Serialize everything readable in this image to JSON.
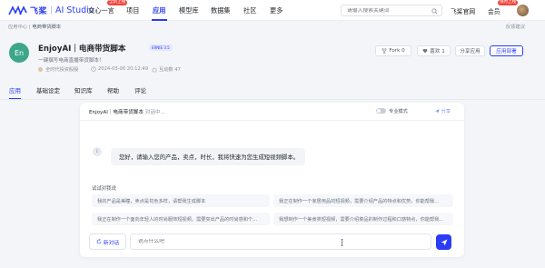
{
  "nav": {
    "logo_cn": "飞桨",
    "logo_en": "AI Studio",
    "items": [
      "文心一言",
      "项目",
      "应用",
      "模型库",
      "数据集",
      "社区",
      "更多"
    ],
    "active_index": 2,
    "badge_wenxin": "全新上线",
    "search_placeholder": "请输入搜索关键词",
    "official_site": "飞桨官网",
    "member": "会员",
    "member_badge": "限时上线"
  },
  "breadcrumb": {
    "parent": "应用中心",
    "sep": " | ",
    "current": "电商带货脚本"
  },
  "feedback": "反馈建议",
  "app": {
    "icon_text": "En",
    "title": "EnjoyAI｜电商带货脚本",
    "tag": "ERNIE 3.5",
    "description": "一键撰写电商直播带货脚本！",
    "author": "全时代投资股殷",
    "date": "2024-03-06 20:12:49",
    "usage": "互动数 47",
    "buttons": {
      "fork": "Fork 0",
      "like": "喜欢 1",
      "share": "分享应用",
      "deploy": "应用部署"
    }
  },
  "tabs": [
    "应用",
    "基础设定",
    "知识库",
    "帮助",
    "评论"
  ],
  "chat": {
    "title": "EnjoyAI｜电商带货脚本",
    "subtitle": "对话中...",
    "pro_mode": "专业模式",
    "share": "分享",
    "avatar_text": "E",
    "greeting": "您好，请输入您的产品，卖点，时长，我将快速为您生成短视频脚本。",
    "try_title": "试试对我说",
    "suggestions": [
      "我的产品是美瞳，卖点是花色多样，请帮我生成脚本",
      "我正在制作一个家居用品的短视频，需要介绍产品的特点和优势，你能帮我...",
      "我正在制作一个面向年轻人的时尚服饰短视频，需要突出产品的时尚感和个...",
      "我想制作一个美食类短视频，需要介绍菜品的制作过程和口感特点，你能帮我..."
    ],
    "new_chat": "新对话",
    "input_placeholder": "说点什么吧"
  }
}
